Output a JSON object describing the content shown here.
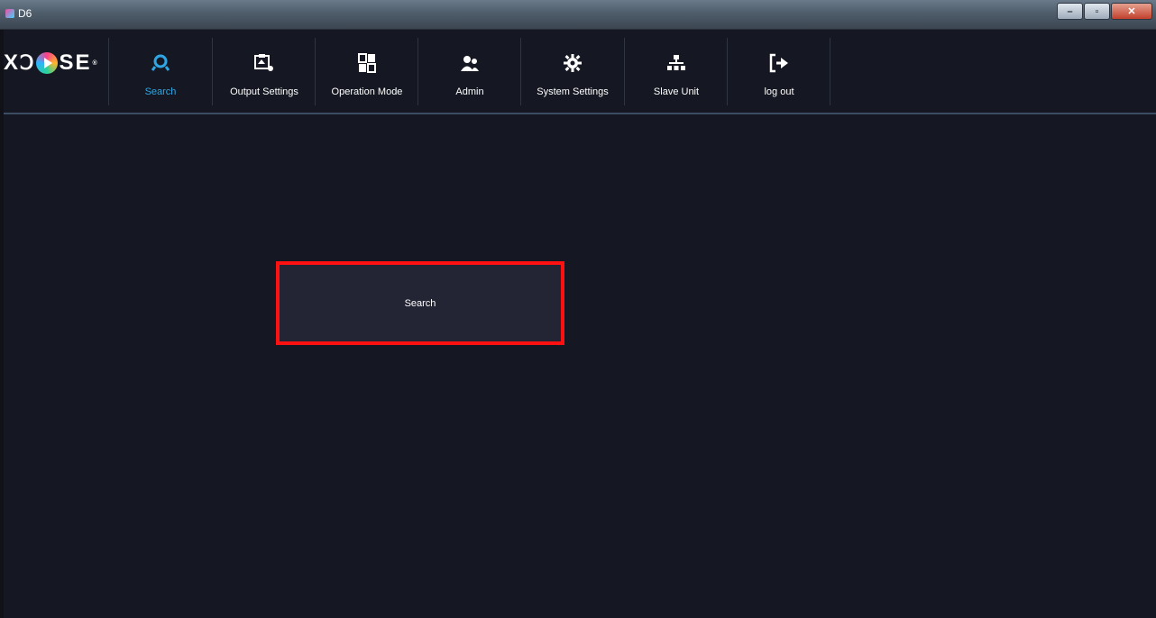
{
  "window": {
    "title": "D6"
  },
  "logo": {
    "text_left": "X",
    "text_right": "SE",
    "registered": "®"
  },
  "nav": {
    "items": [
      {
        "label": "Search",
        "icon": "search-icon",
        "active": true
      },
      {
        "label": "Output Settings",
        "icon": "output-settings-icon"
      },
      {
        "label": "Operation Mode",
        "icon": "operation-mode-icon"
      },
      {
        "label": "Admin",
        "icon": "admin-icon"
      },
      {
        "label": "System Settings",
        "icon": "gear-icon"
      },
      {
        "label": "Slave Unit",
        "icon": "network-icon"
      },
      {
        "label": "log out",
        "icon": "logout-icon"
      }
    ]
  },
  "main": {
    "search_button_label": "Search"
  },
  "colors": {
    "background": "#151822",
    "accent": "#2fa6e3",
    "highlight": "#ff1111"
  }
}
